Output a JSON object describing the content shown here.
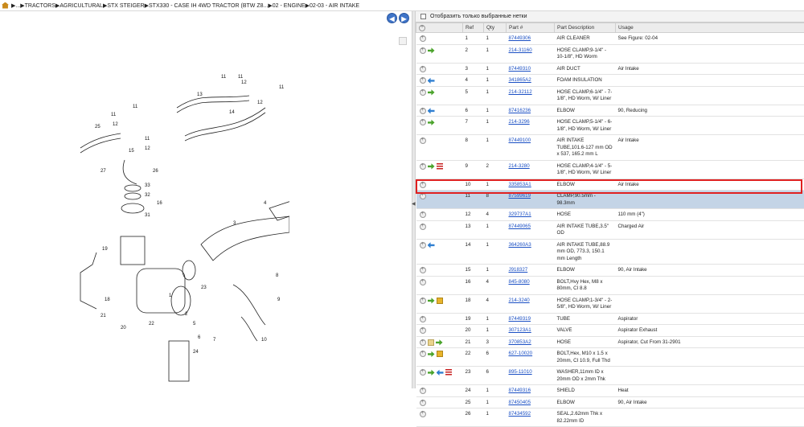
{
  "breadcrumb": {
    "items": [
      "...",
      "TRACTORS",
      "AGRICULTURAL",
      "STX STEIGER",
      "STX330 - CASE IH 4WD TRACTOR (BTW Z8...",
      "02 - ENGINE",
      "02-03 - AIR INTAKE"
    ]
  },
  "nav": {
    "back": "◀",
    "forward": "▶"
  },
  "filter": {
    "label": "Отобразить только выбранные нетки"
  },
  "table": {
    "headers": {
      "ref": "Ref",
      "qty": "Qty",
      "part": "Part #",
      "desc": "Part Description",
      "usage": "Usage"
    },
    "rows": [
      {
        "ref": "1",
        "qty": "1",
        "part": "87449306",
        "desc": "AIR CLEANER",
        "usage": "See Figure: 02-04",
        "icons": []
      },
      {
        "ref": "2",
        "qty": "1",
        "part": "214-31160",
        "desc": "HOSE CLAMP,9-1/4\" - 10-1/8\", HD Worm",
        "usage": "",
        "icons": [
          "arrow-green"
        ]
      },
      {
        "ref": "3",
        "qty": "1",
        "part": "87449310",
        "desc": "AIR DUCT",
        "usage": "Air Intake",
        "icons": []
      },
      {
        "ref": "4",
        "qty": "1",
        "part": "341865A2",
        "desc": "FOAM INSULATION",
        "usage": "",
        "icons": [
          "arrow-blue"
        ]
      },
      {
        "ref": "5",
        "qty": "1",
        "part": "214-32112",
        "desc": "HOSE CLAMP,6-1/4\" - 7-1/8\", HD Worm, W/ Liner",
        "usage": "",
        "icons": [
          "arrow-green"
        ]
      },
      {
        "ref": "6",
        "qty": "1",
        "part": "87416236",
        "desc": "ELBOW",
        "usage": "90, Reducing",
        "icons": [
          "arrow-blue"
        ]
      },
      {
        "ref": "7",
        "qty": "1",
        "part": "214-3296",
        "desc": "HOSE CLAMP,5-1/4\" - 6-1/8\", HD Worm, W/ Liner",
        "usage": "",
        "icons": [
          "arrow-green"
        ]
      },
      {
        "ref": "8",
        "qty": "1",
        "part": "87449100",
        "desc": "AIR INTAKE TUBE,101.6-127 mm OD x 537, 165.2 mm L",
        "usage": "Air Intake",
        "icons": []
      },
      {
        "ref": "9",
        "qty": "2",
        "part": "214-3280",
        "desc": "HOSE CLAMP,4-1/4\" - 5-1/8\", HD Worm, W/ Liner",
        "usage": "",
        "icons": [
          "arrow-green",
          "list-red"
        ]
      },
      {
        "ref": "10",
        "qty": "1",
        "part": "335853A1",
        "desc": "ELBOW",
        "usage": "Air Intake",
        "icons": []
      },
      {
        "ref": "11",
        "qty": "8",
        "part": "87599619",
        "desc": "CLAMP,90.5mm - 98.3mm",
        "usage": "",
        "icons": [],
        "selected": true
      },
      {
        "ref": "12",
        "qty": "4",
        "part": "329737A1",
        "desc": "HOSE",
        "usage": "110 mm (4\")",
        "icons": []
      },
      {
        "ref": "13",
        "qty": "1",
        "part": "87449065",
        "desc": "AIR INTAKE TUBE,3.5\" OD",
        "usage": "Charged Air",
        "icons": []
      },
      {
        "ref": "14",
        "qty": "1",
        "part": "364260A3",
        "desc": "AIR INTAKE TUBE,88.9 mm OD, 773.3, 150.1 mm Length",
        "usage": "",
        "icons": [
          "arrow-blue"
        ]
      },
      {
        "ref": "15",
        "qty": "1",
        "part": "J918327",
        "desc": "ELBOW",
        "usage": "90, Air Intake",
        "icons": []
      },
      {
        "ref": "16",
        "qty": "4",
        "part": "845-8080",
        "desc": "BOLT,Hvy Hex, M8 x 80mm, CI 8.8",
        "usage": "",
        "icons": []
      },
      {
        "ref": "18",
        "qty": "4",
        "part": "214-3240",
        "desc": "HOSE CLAMP,1-3/4\" - 2-5/8\", HD Worm, W/ Liner",
        "usage": "",
        "icons": [
          "arrow-green",
          "box-yellow"
        ]
      },
      {
        "ref": "19",
        "qty": "1",
        "part": "87449319",
        "desc": "TUBE",
        "usage": "Aspirator",
        "icons": []
      },
      {
        "ref": "20",
        "qty": "1",
        "part": "307123A1",
        "desc": "VALVE",
        "usage": "Aspirator Exhaust",
        "icons": []
      },
      {
        "ref": "21",
        "qty": "3",
        "part": "370853A2",
        "desc": "HOSE",
        "usage": "Aspirator, Cut From 31-2901",
        "icons": [
          "note",
          "arrow-green"
        ]
      },
      {
        "ref": "22",
        "qty": "6",
        "part": "627-10020",
        "desc": "BOLT,Hex, M10 x 1.5 x 20mm, CI 10.9, Full Thd",
        "usage": "",
        "icons": [
          "arrow-green",
          "box-yellow"
        ]
      },
      {
        "ref": "23",
        "qty": "6",
        "part": "895-11010",
        "desc": "WASHER,11mm ID x 20mm OD x 2mm Thk",
        "usage": "",
        "icons": [
          "arrow-green",
          "arrow-blue",
          "list-red"
        ]
      },
      {
        "ref": "24",
        "qty": "1",
        "part": "87449316",
        "desc": "SHIELD",
        "usage": "Heat",
        "icons": []
      },
      {
        "ref": "25",
        "qty": "1",
        "part": "87450405",
        "desc": "ELBOW",
        "usage": "90, Air Intake",
        "icons": []
      },
      {
        "ref": "26",
        "qty": "1",
        "part": "87434592",
        "desc": "SEAL,2.62mm Thk x 82.22mm ID",
        "usage": "",
        "icons": []
      }
    ]
  },
  "drawing": {
    "callouts": [
      "1",
      "2",
      "3",
      "4",
      "5",
      "6",
      "7",
      "8",
      "9",
      "10",
      "11",
      "12",
      "13",
      "14",
      "15",
      "16",
      "18",
      "19",
      "20",
      "21",
      "22",
      "23",
      "24",
      "25",
      "26",
      "27",
      "31",
      "32",
      "33"
    ]
  }
}
